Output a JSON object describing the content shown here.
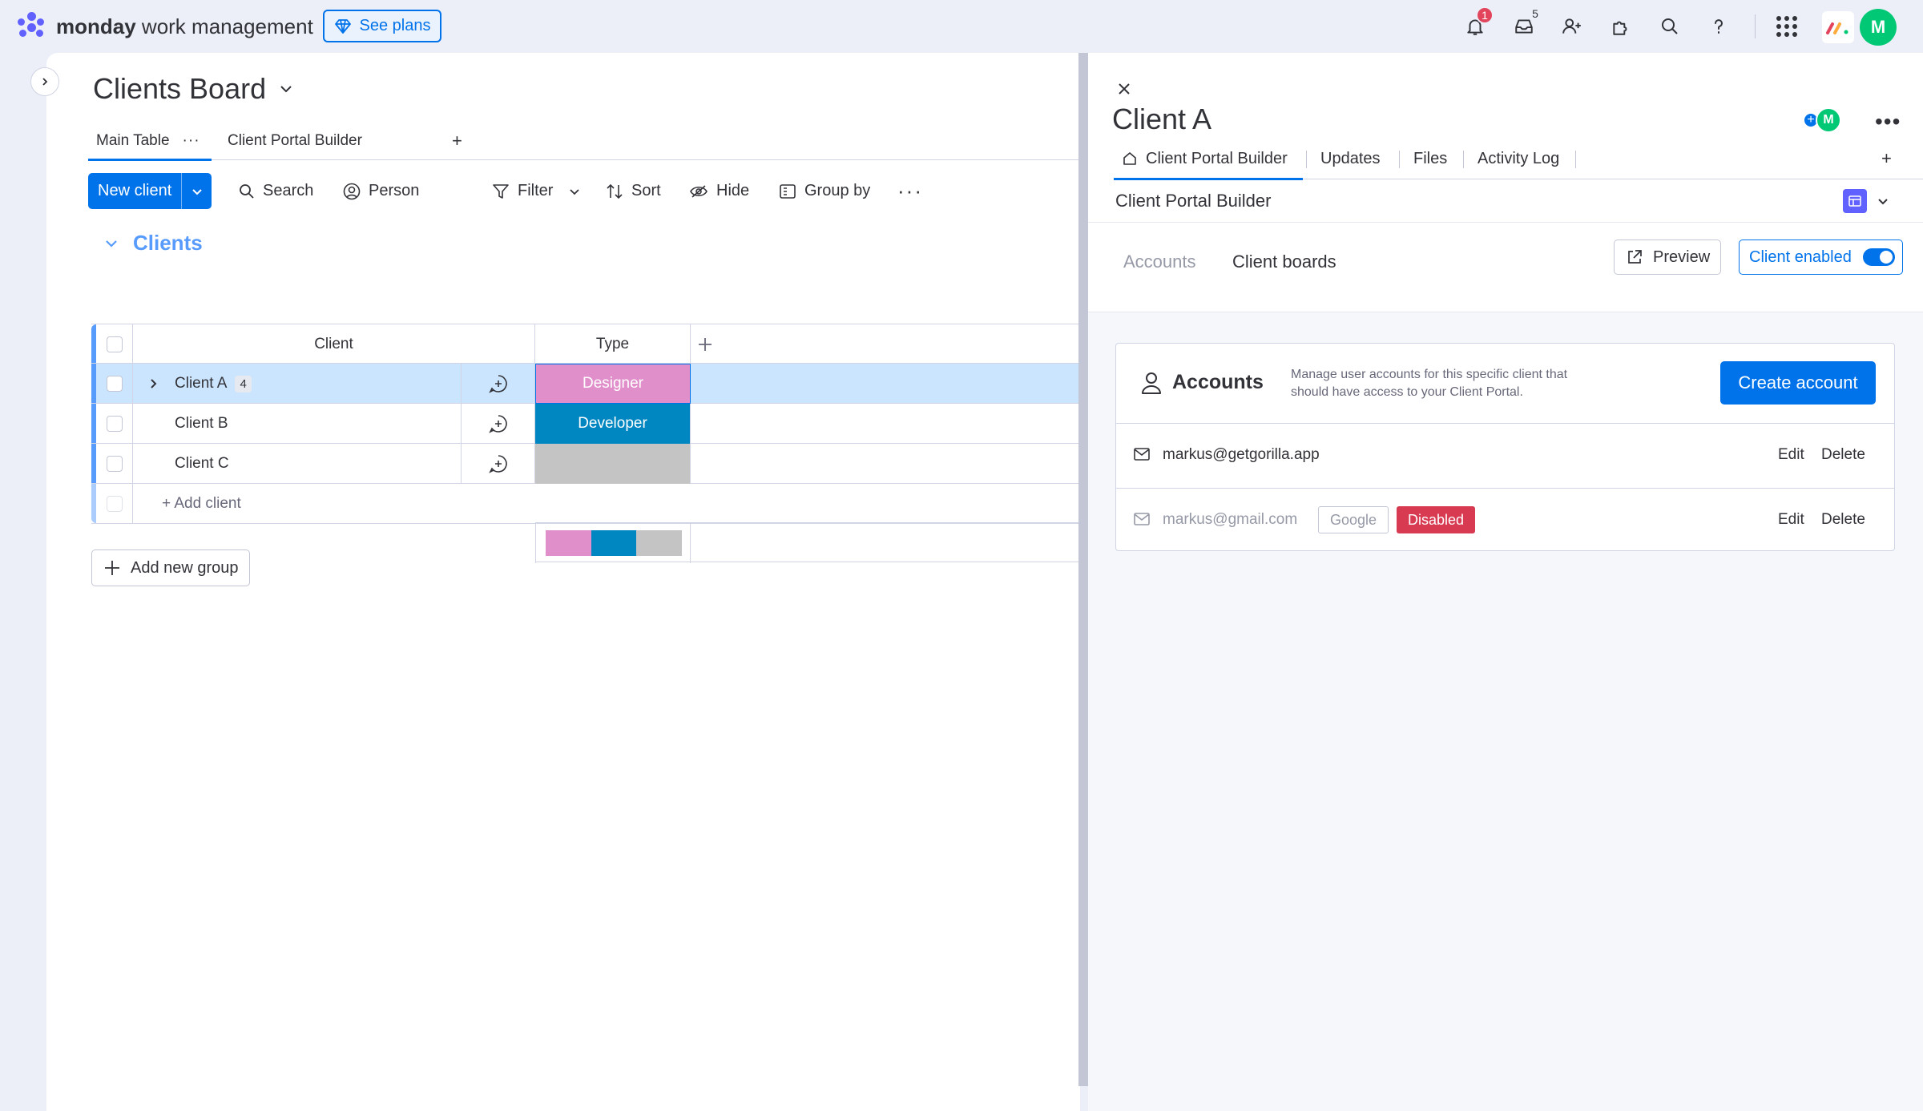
{
  "topbar": {
    "brand_bold": "monday",
    "brand_rest": " work management",
    "see_plans": "See plans",
    "notifications_count": "1",
    "inbox_count": "5",
    "avatar_initial": "M"
  },
  "board": {
    "title": "Clients Board",
    "tabs": [
      {
        "label": "Main Table",
        "active": true
      },
      {
        "label": "Client Portal Builder",
        "active": false
      }
    ],
    "add_tab": "+",
    "toolbar": {
      "new_item": "New client",
      "search": "Search",
      "person": "Person",
      "filter": "Filter",
      "sort": "Sort",
      "hide": "Hide",
      "group_by": "Group by"
    },
    "group": {
      "title": "Clients",
      "color": "#579bfc",
      "columns": {
        "item": "Client",
        "type": "Type"
      },
      "rows": [
        {
          "name": "Client A",
          "count": "4",
          "type": "Designer",
          "type_color": "#e08fcb",
          "selected": true
        },
        {
          "name": "Client B",
          "count": "",
          "type": "Developer",
          "type_color": "#0086c0",
          "selected": false
        },
        {
          "name": "Client C",
          "count": "",
          "type": "",
          "type_color": "#c4c4c4",
          "selected": false
        }
      ],
      "add_item": "+ Add client",
      "summary_colors": [
        "#e08fcb",
        "#0086c0",
        "#c4c4c4"
      ]
    },
    "add_group": "Add new group"
  },
  "panel": {
    "title": "Client A",
    "avatar_initial": "M",
    "tabs": [
      {
        "label": "Client Portal Builder",
        "active": true
      },
      {
        "label": "Updates",
        "active": false
      },
      {
        "label": "Files",
        "active": false
      },
      {
        "label": "Activity Log",
        "active": false
      }
    ],
    "section_title": "Client Portal Builder",
    "subtabs": {
      "accounts": "Accounts",
      "client_boards": "Client boards"
    },
    "preview": "Preview",
    "client_enabled": "Client enabled",
    "accounts_card": {
      "title": "Accounts",
      "description": "Manage user accounts for this specific client that should have access to your Client Portal.",
      "create_button": "Create account",
      "rows": [
        {
          "email": "markus@getgorilla.app",
          "google": "",
          "status": "",
          "edit": "Edit",
          "delete": "Delete"
        },
        {
          "email": "markus@gmail.com",
          "google": "Google",
          "status": "Disabled",
          "edit": "Edit",
          "delete": "Delete"
        }
      ]
    }
  }
}
